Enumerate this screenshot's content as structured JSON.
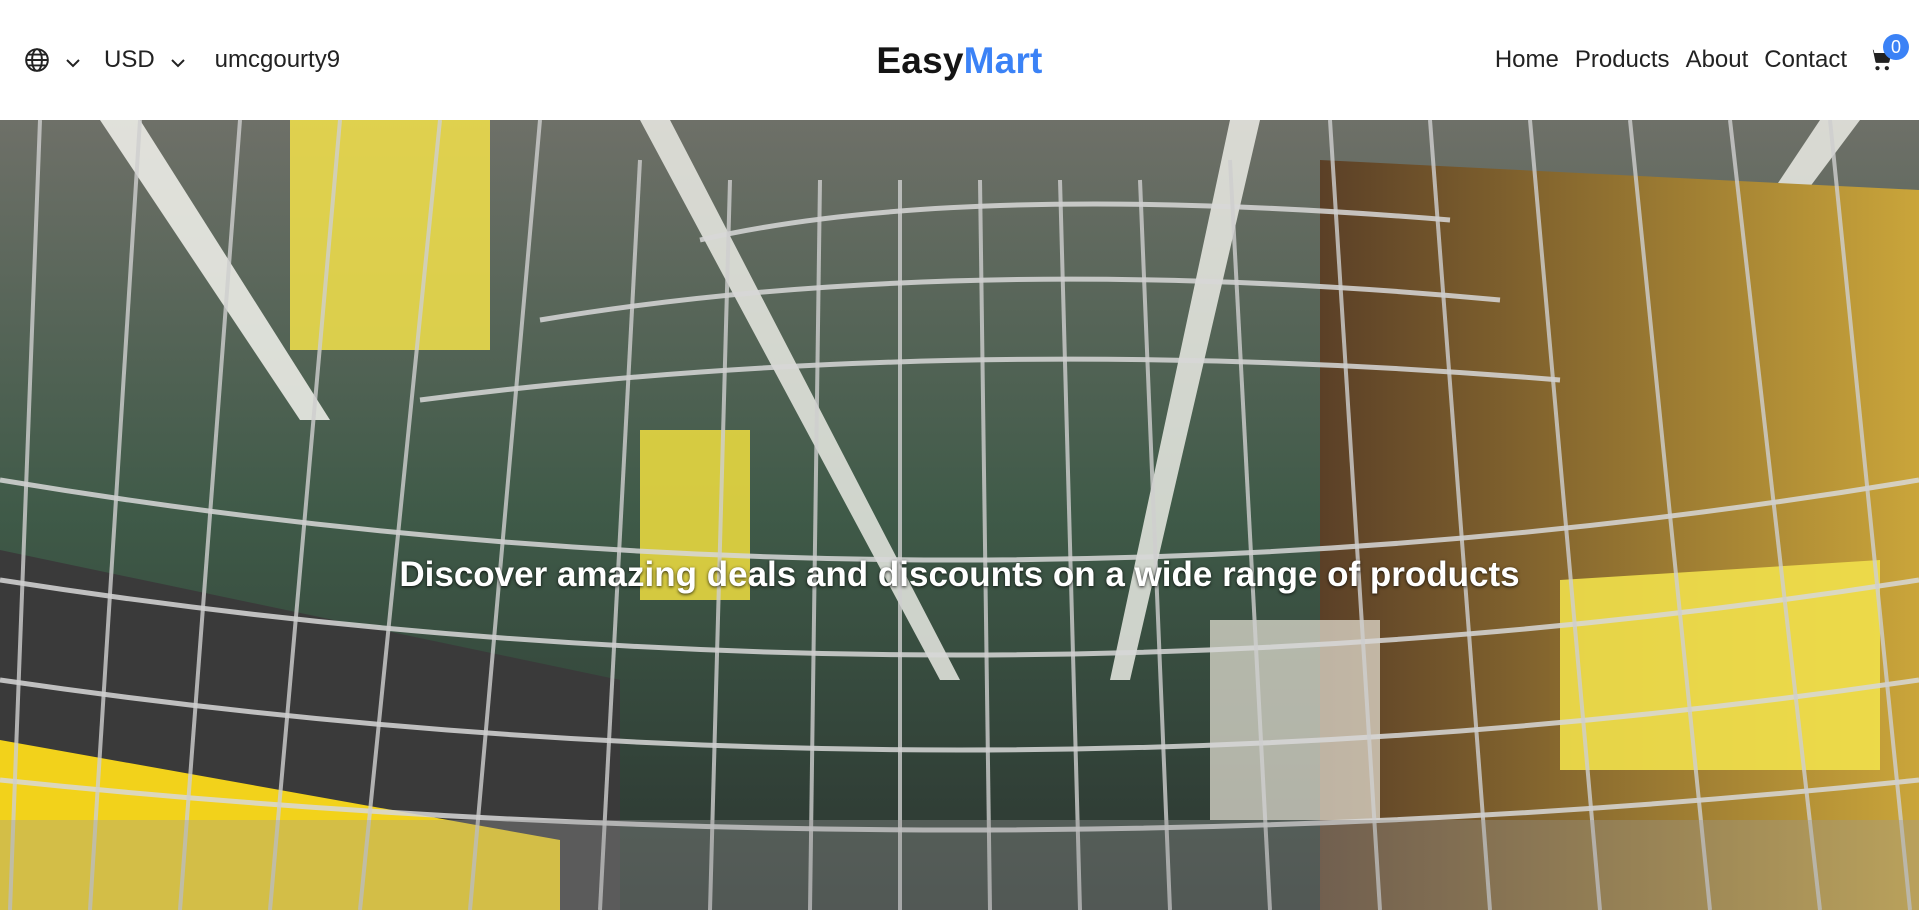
{
  "header": {
    "language_icon": "globe-icon",
    "currency": "USD",
    "username": "umcgourty9",
    "logo": {
      "part1": "Easy",
      "part2": "Mart"
    },
    "nav": [
      {
        "label": "Home"
      },
      {
        "label": "Products"
      },
      {
        "label": "About"
      },
      {
        "label": "Contact"
      }
    ],
    "cart_icon": "cart-icon",
    "cart_count": "0"
  },
  "hero": {
    "headline": "Discover amazing deals and discounts on a wide range of products"
  },
  "colors": {
    "accent": "#3b82f6",
    "logo_dark": "#141414",
    "hero_text": "#ffffff"
  }
}
